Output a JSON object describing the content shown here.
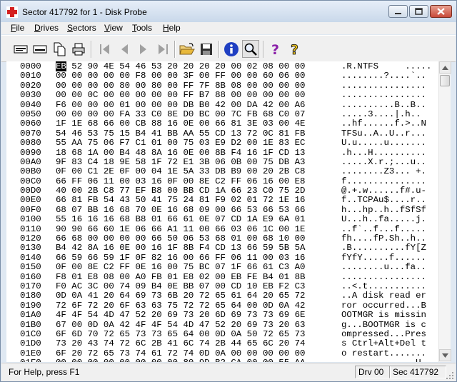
{
  "window": {
    "title": "Sector 417792 for 1 - Disk Probe",
    "minimize_label": "_",
    "maximize_label": "□",
    "close_label": "✕"
  },
  "menu": [
    {
      "label": "File",
      "accel": "F",
      "rest": "ile"
    },
    {
      "label": "Drives",
      "accel": "D",
      "rest": "rives"
    },
    {
      "label": "Sectors",
      "accel": "S",
      "rest": "ectors"
    },
    {
      "label": "View",
      "accel": "V",
      "rest": "iew"
    },
    {
      "label": "Tools",
      "accel": "T",
      "rest": "ools"
    },
    {
      "label": "Help",
      "accel": "H",
      "rest": "elp"
    }
  ],
  "toolbar": {
    "buttons": [
      "read-sector-icon",
      "write-sector-icon",
      "copy-icon",
      "print-icon",
      "first-sector-icon",
      "previous-sector-icon",
      "next-sector-icon",
      "last-sector-icon",
      "open-folder-icon",
      "save-icon",
      "info-icon",
      "search-icon",
      "help-icon",
      "context-help-icon"
    ],
    "colors": {
      "info": "#1f3fc2",
      "help": "#8a1fa8",
      "folder": "#e8b93c"
    }
  },
  "hex_view": {
    "rows": [
      {
        "addr": "0000",
        "hex": "EB 52 90 4E 54 46 53 20 20 20 20 00 02 08 00 00",
        "ascii": ".R.NTFS     ....."
      },
      {
        "addr": "0010",
        "hex": "00 00 00 00 00 F8 00 00 3F 00 FF 00 00 60 06 00",
        "ascii": "........?....`.."
      },
      {
        "addr": "0020",
        "hex": "00 00 00 00 80 00 80 00 FF 7F 8B 08 00 00 00 00",
        "ascii": "................"
      },
      {
        "addr": "0030",
        "hex": "00 00 0C 00 00 00 00 00 FF B7 88 00 00 00 00 00",
        "ascii": "................"
      },
      {
        "addr": "0040",
        "hex": "F6 00 00 00 01 00 00 00 DB B0 42 00 DA 42 00 A6",
        "ascii": "..........B..B.."
      },
      {
        "addr": "0050",
        "hex": "00 00 00 00 FA 33 C0 8E D0 BC 00 7C FB 68 C0 07",
        "ascii": ".....3....|.h.."
      },
      {
        "addr": "0060",
        "hex": "1F 1E 68 66 00 CB 88 16 0E 00 66 81 3E 03 00 4E",
        "ascii": "..hf......f.>..N"
      },
      {
        "addr": "0070",
        "hex": "54 46 53 75 15 B4 41 BB AA 55 CD 13 72 0C 81 FB",
        "ascii": "TFSu..A..U..r..."
      },
      {
        "addr": "0080",
        "hex": "55 AA 75 06 F7 C1 01 00 75 03 E9 D2 00 1E 83 EC",
        "ascii": "U.u.....u......."
      },
      {
        "addr": "0090",
        "hex": "18 68 1A 00 B4 48 8A 16 0E 00 8B F4 16 1F CD 13",
        "ascii": ".h...H.........."
      },
      {
        "addr": "00A0",
        "hex": "9F 83 C4 18 9E 58 1F 72 E1 3B 06 0B 00 75 DB A3",
        "ascii": ".....X.r.;...u.."
      },
      {
        "addr": "00B0",
        "hex": "0F 00 C1 2E 0F 00 04 1E 5A 33 DB B9 00 20 2B C8",
        "ascii": "........Z3... +."
      },
      {
        "addr": "00C0",
        "hex": "66 FF 06 11 00 03 16 0F 00 8E C2 FF 06 16 00 E8",
        "ascii": "f..............."
      },
      {
        "addr": "00D0",
        "hex": "40 00 2B C8 77 EF B8 00 BB CD 1A 66 23 C0 75 2D",
        "ascii": "@.+.w......f#.u-"
      },
      {
        "addr": "00E0",
        "hex": "66 81 FB 54 43 50 41 75 24 81 F9 02 01 72 1E 16",
        "ascii": "f..TCPAu$....r.."
      },
      {
        "addr": "00F0",
        "hex": "68 07 BB 16 68 70 0E 16 68 09 00 66 53 66 53 66",
        "ascii": "h...hp..h..fSfSf"
      },
      {
        "addr": "0100",
        "hex": "55 16 16 16 68 B8 01 66 61 0E 07 CD 1A E9 6A 01",
        "ascii": "U...h..fa.....j."
      },
      {
        "addr": "0110",
        "hex": "90 90 66 60 1E 06 66 A1 11 00 66 03 06 1C 00 1E",
        "ascii": "..f`..f...f....."
      },
      {
        "addr": "0120",
        "hex": "66 68 00 00 00 00 66 50 06 53 68 01 00 68 10 00",
        "ascii": "fh....fP.Sh..h.."
      },
      {
        "addr": "0130",
        "hex": "B4 42 8A 16 0E 00 16 1F 8B F4 CD 13 66 59 5B 5A",
        "ascii": ".B..........fY[Z"
      },
      {
        "addr": "0140",
        "hex": "66 59 66 59 1F 0F 82 16 00 66 FF 06 11 00 03 16",
        "ascii": "fYfY.....f......"
      },
      {
        "addr": "0150",
        "hex": "0F 00 8E C2 FF 0E 16 00 75 BC 07 1F 66 61 C3 A0",
        "ascii": "........u...fa.."
      },
      {
        "addr": "0160",
        "hex": "F8 01 E8 08 00 A0 FB 01 E8 02 00 EB FE B4 01 8B",
        "ascii": "................"
      },
      {
        "addr": "0170",
        "hex": "F0 AC 3C 00 74 09 B4 0E BB 07 00 CD 10 EB F2 C3",
        "ascii": "..<.t..........."
      },
      {
        "addr": "0180",
        "hex": "0D 0A 41 20 64 69 73 6B 20 72 65 61 64 20 65 72",
        "ascii": "..A disk read er"
      },
      {
        "addr": "0190",
        "hex": "72 6F 72 20 6F 63 63 75 72 72 65 64 00 0D 0A 42",
        "ascii": "ror occurred...B"
      },
      {
        "addr": "01A0",
        "hex": "4F 4F 54 4D 47 52 20 69 73 20 6D 69 73 73 69 6E",
        "ascii": "OOTMGR is missin"
      },
      {
        "addr": "01B0",
        "hex": "67 00 0D 0A 42 4F 4F 54 4D 47 52 20 69 73 20 63",
        "ascii": "g...BOOTMGR is c"
      },
      {
        "addr": "01C0",
        "hex": "6F 6D 70 72 65 73 73 65 64 00 0D 0A 50 72 65 73",
        "ascii": "ompressed...Pres"
      },
      {
        "addr": "01D0",
        "hex": "73 20 43 74 72 6C 2B 41 6C 74 2B 44 65 6C 20 74",
        "ascii": "s Ctrl+Alt+Del t"
      },
      {
        "addr": "01E0",
        "hex": "6F 20 72 65 73 74 61 72 74 0D 0A 00 00 00 00 00",
        "ascii": "o restart......."
      },
      {
        "addr": "01F0",
        "hex": "00 00 00 00 00 00 00 00 80 9D B2 CA 00 00 55 AA",
        "ascii": "..............U."
      }
    ],
    "cursor_byte": "EB"
  },
  "status": {
    "help_text": "For Help, press F1",
    "drive": "Drv 00",
    "sector": "Sec 417792"
  }
}
